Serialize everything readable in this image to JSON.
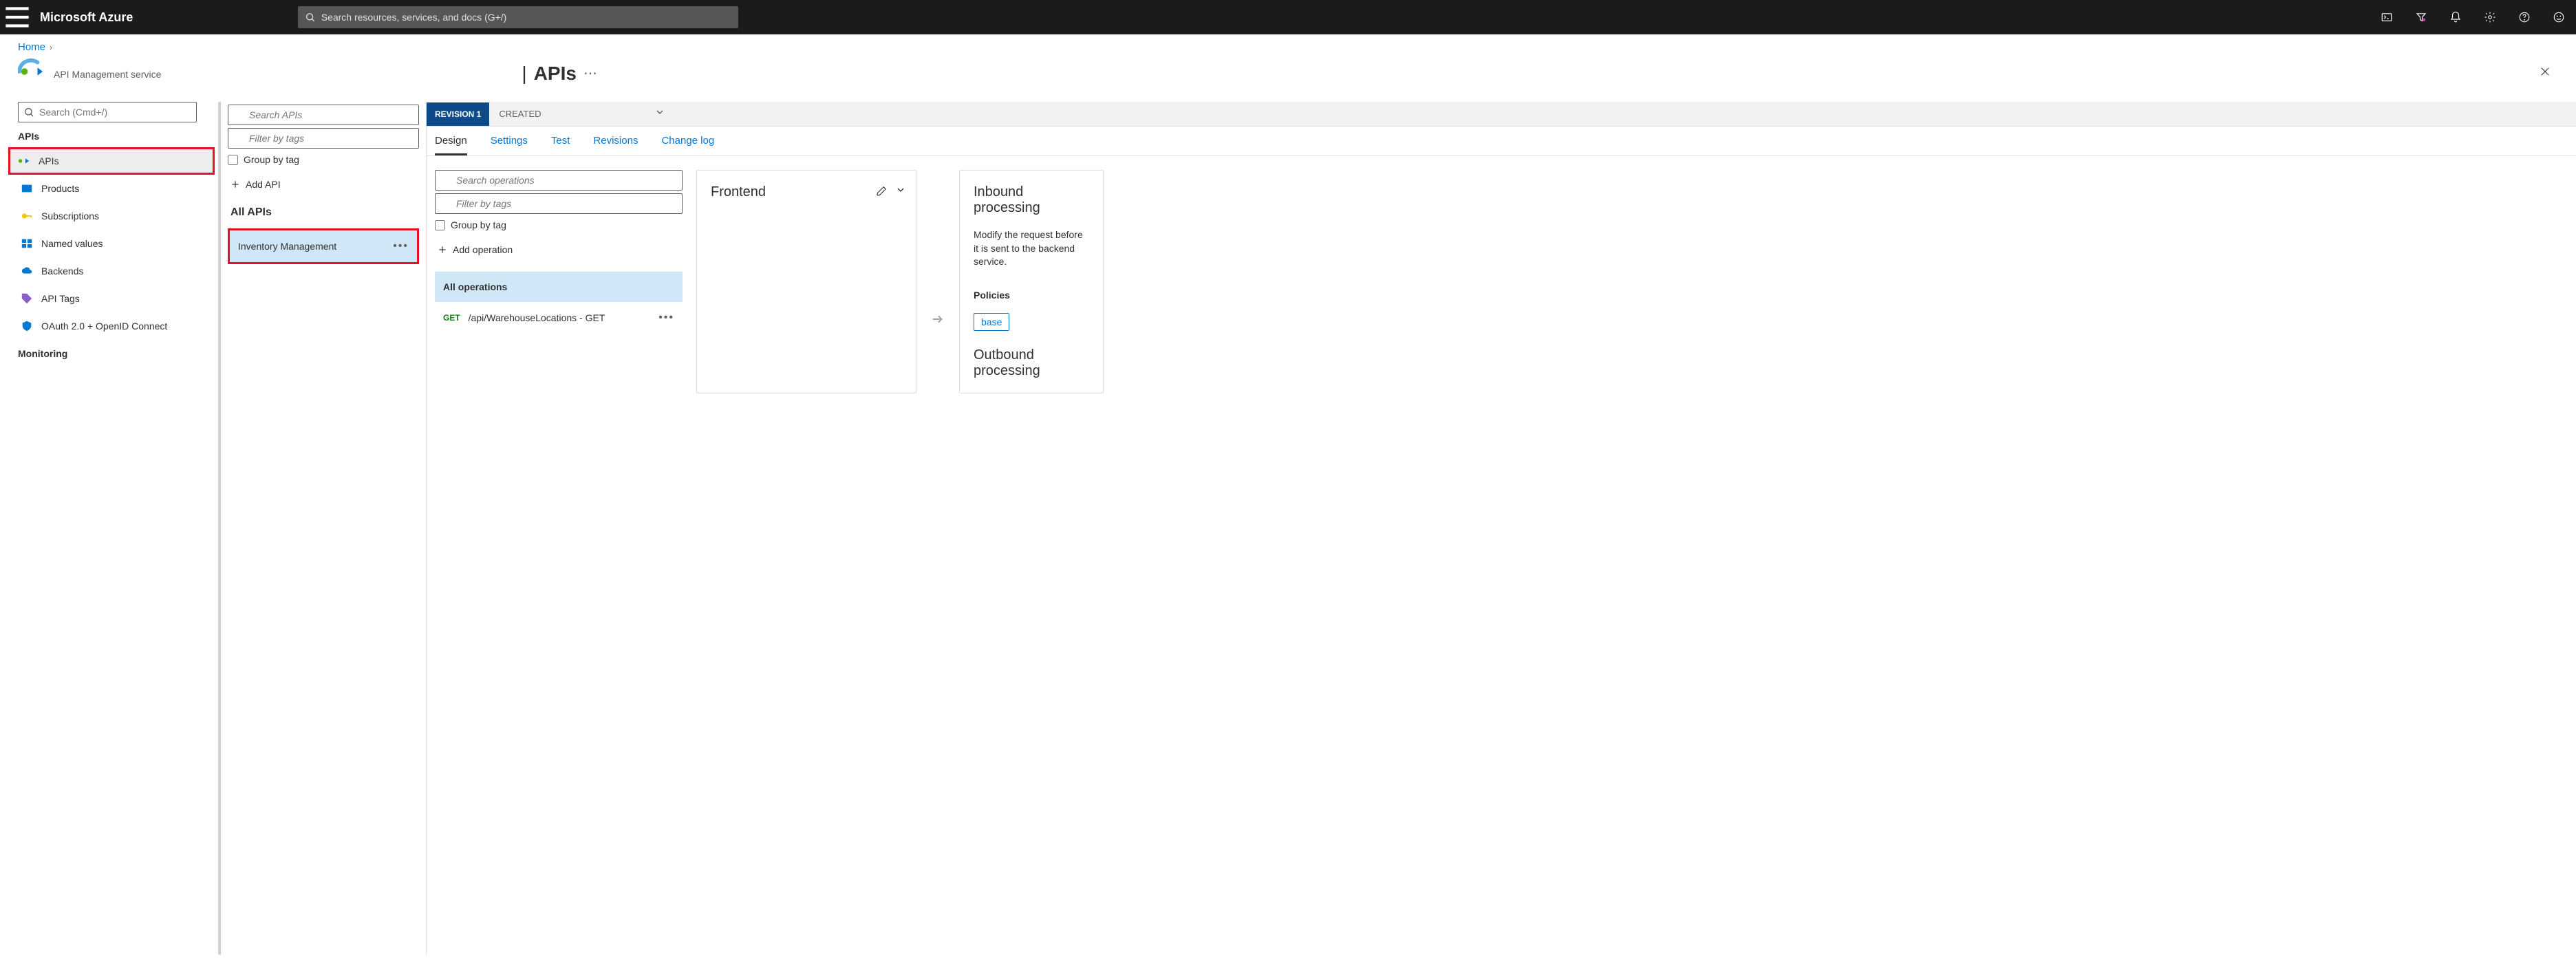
{
  "header": {
    "brand": "Microsoft Azure",
    "search_placeholder": "Search resources, services, and docs (G+/)"
  },
  "breadcrumb": {
    "home": "Home"
  },
  "page": {
    "title": "APIs",
    "subtitle": "API Management service"
  },
  "sidebar": {
    "search_placeholder": "Search (Cmd+/)",
    "section_apis": "APIs",
    "items": [
      {
        "label": "APIs"
      },
      {
        "label": "Products"
      },
      {
        "label": "Subscriptions"
      },
      {
        "label": "Named values"
      },
      {
        "label": "Backends"
      },
      {
        "label": "API Tags"
      },
      {
        "label": "OAuth 2.0 + OpenID Connect"
      }
    ],
    "section_monitoring": "Monitoring"
  },
  "api_list": {
    "search_placeholder": "Search APIs",
    "filter_placeholder": "Filter by tags",
    "group_by_tag": "Group by tag",
    "add_api": "Add API",
    "all_apis": "All APIs",
    "selected_api": "Inventory Management"
  },
  "revision": {
    "label": "REVISION 1",
    "created": "CREATED"
  },
  "tabs": [
    {
      "label": "Design"
    },
    {
      "label": "Settings"
    },
    {
      "label": "Test"
    },
    {
      "label": "Revisions"
    },
    {
      "label": "Change log"
    }
  ],
  "operations": {
    "search_placeholder": "Search operations",
    "filter_placeholder": "Filter by tags",
    "group_by_tag": "Group by tag",
    "add_operation": "Add operation",
    "all_operations": "All operations",
    "list": [
      {
        "method": "GET",
        "name": "/api/WarehouseLocations - GET"
      }
    ]
  },
  "frontend": {
    "title": "Frontend"
  },
  "inbound": {
    "title": "Inbound processing",
    "desc": "Modify the request before it is sent to the backend service.",
    "policies_h": "Policies",
    "base": "base"
  },
  "outbound": {
    "title": "Outbound processing"
  }
}
